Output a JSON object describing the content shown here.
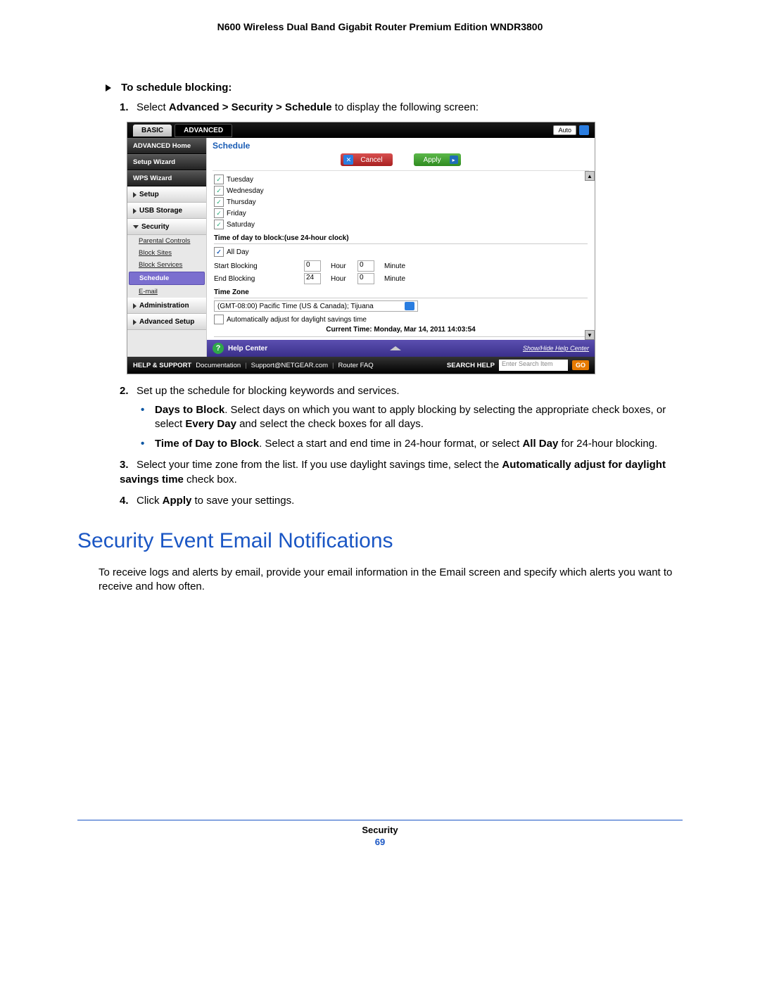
{
  "doc_header": "N600 Wireless Dual Band Gigabit Router Premium Edition WNDR3800",
  "task_heading": "To schedule blocking:",
  "step1_a": "Select ",
  "step1_b": "Advanced > Security > Schedule",
  "step1_c": " to display the following screen:",
  "step2": "Set up the schedule for blocking keywords and services.",
  "bullet1_a": "Days to Block",
  "bullet1_b": ". Select days on which you want to apply blocking by selecting the appropriate check boxes, or select ",
  "bullet1_c": "Every Day",
  "bullet1_d": " and select the check boxes for all days.",
  "bullet2_a": "Time of Day to Block",
  "bullet2_b": ". Select a start and end time in 24-hour format, or select ",
  "bullet2_c": "All Day",
  "bullet2_d": " for 24-hour blocking.",
  "step3_a": "Select your time zone from the list. If you use daylight savings time, select the ",
  "step3_b": "Automatically adjust for daylight savings time",
  "step3_c": " check box.",
  "step4_a": "Click ",
  "step4_b": "Apply",
  "step4_c": " to save your settings.",
  "section_heading": "Security Event Email Notifications",
  "body_para": "To receive logs and alerts by email, provide your email information in the Email screen and specify which alerts you want to receive and how often.",
  "footer_label": "Security",
  "footer_page": "69",
  "ui": {
    "tab_basic": "BASIC",
    "tab_advanced": "ADVANCED",
    "auto": "Auto",
    "sidebar": {
      "advanced_home": "ADVANCED Home",
      "setup_wizard": "Setup Wizard",
      "wps_wizard": "WPS Wizard",
      "setup": "Setup",
      "usb_storage": "USB Storage",
      "security": "Security",
      "parental": "Parental Controls",
      "block_sites": "Block Sites",
      "block_services": "Block Services",
      "schedule": "Schedule",
      "email": "E-mail",
      "administration": "Administration",
      "advanced_setup": "Advanced Setup"
    },
    "content_title": "Schedule",
    "cancel": "Cancel",
    "apply": "Apply",
    "days": {
      "tue": "Tuesday",
      "wed": "Wednesday",
      "thu": "Thursday",
      "fri": "Friday",
      "sat": "Saturday"
    },
    "time_section": "Time of day to block:(use 24-hour clock)",
    "all_day": "All Day",
    "start_blocking": "Start Blocking",
    "end_blocking": "End Blocking",
    "start_h": "0",
    "end_h": "24",
    "hour": "Hour",
    "min_val": "0",
    "minute": "Minute",
    "tz_section": "Time Zone",
    "tz_value": "(GMT-08:00) Pacific Time (US & Canada); Tijuana",
    "dst": "Automatically adjust for daylight savings time",
    "current_time": "Current Time: Monday, Mar 14, 2011 14:03:54",
    "help_center": "Help Center",
    "show_hide": "Show/Hide Help Center",
    "footer": {
      "help_support": "HELP & SUPPORT",
      "documentation": "Documentation",
      "support": "Support@NETGEAR.com",
      "router_faq": "Router FAQ",
      "search_help": "SEARCH HELP",
      "placeholder": "Enter Search Item",
      "go": "GO"
    }
  }
}
